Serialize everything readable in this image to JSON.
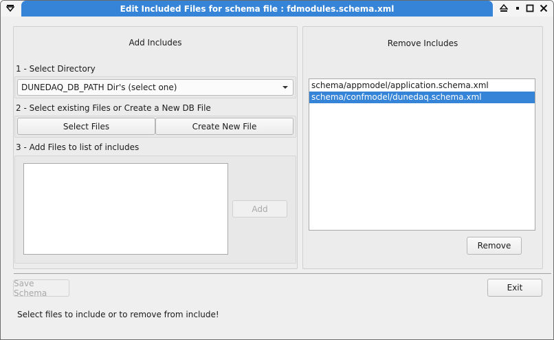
{
  "window": {
    "title": "Edit Included Files for schema file : fdmodules.schema.xml"
  },
  "add_panel": {
    "title": "Add Includes",
    "step1_label": "1 - Select Directory",
    "directory_combo_value": "DUNEDAQ_DB_PATH Dir's (select one)",
    "step2_label": "2 - Select existing Files or Create a New DB File",
    "select_files_label": "Select Files",
    "create_new_file_label": "Create New File",
    "step3_label": "3 - Add Files to list of includes",
    "add_button_label": "Add"
  },
  "remove_panel": {
    "title": "Remove Includes",
    "includes": [
      {
        "path": "schema/appmodel/application.schema.xml",
        "selected": false
      },
      {
        "path": "schema/confmodel/dunedaq.schema.xml",
        "selected": true
      }
    ],
    "remove_button_label": "Remove"
  },
  "footer": {
    "save_schema_label": "Save Schema",
    "exit_label": "Exit",
    "status_text": "Select files to include or to remove from include!"
  }
}
